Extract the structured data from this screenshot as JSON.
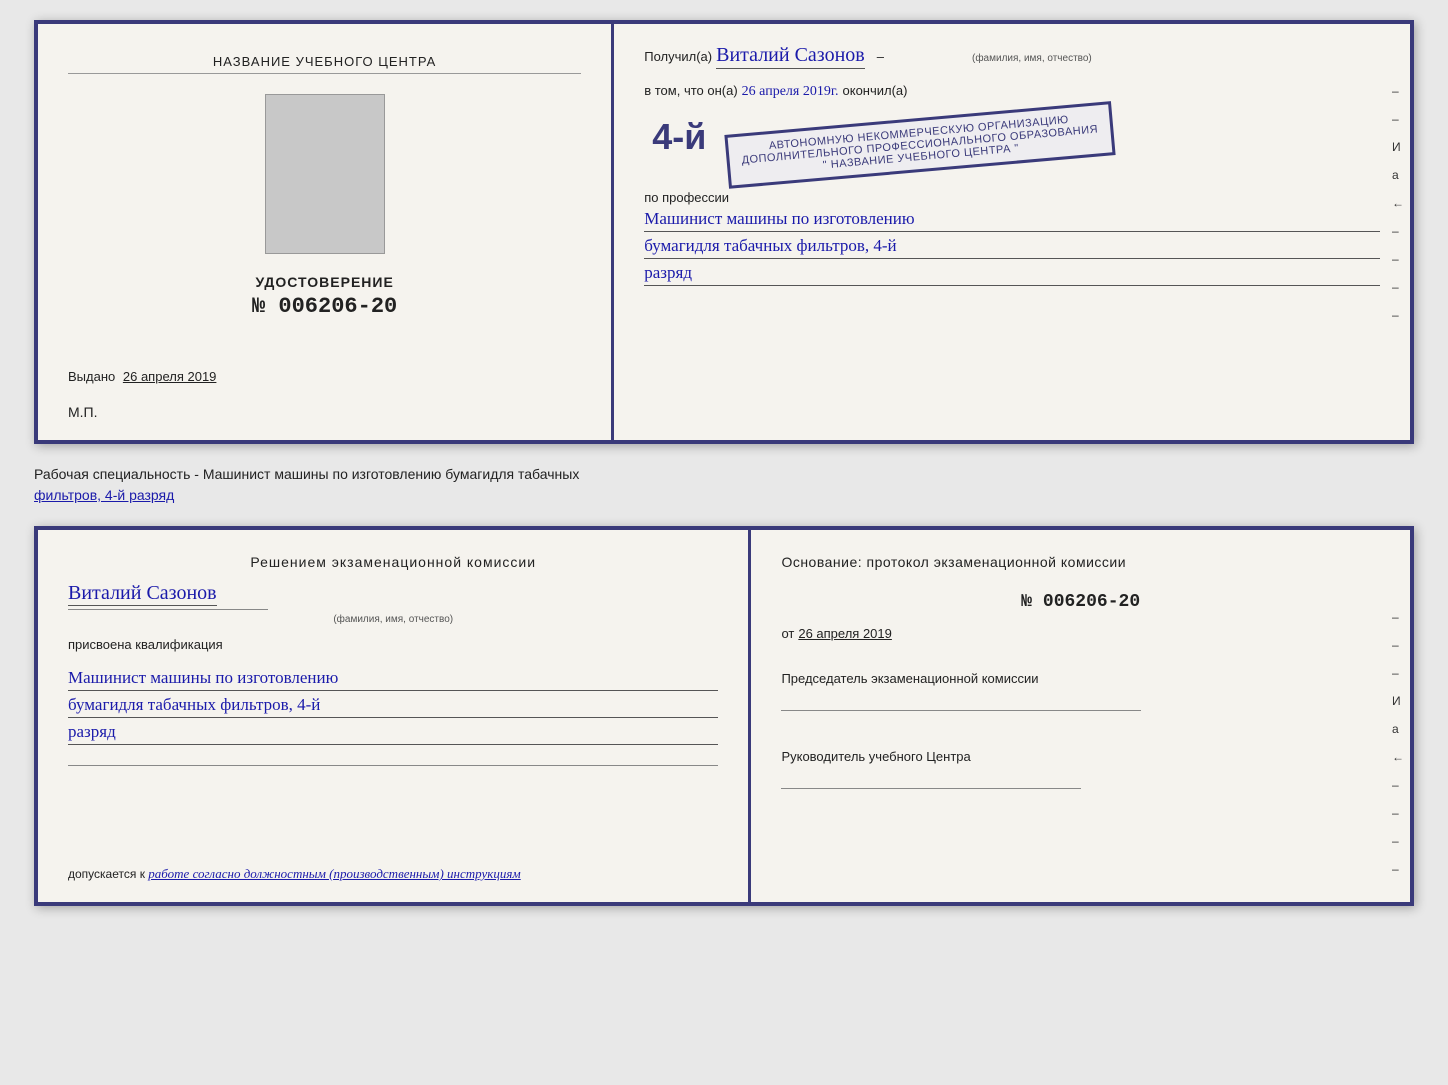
{
  "top_left": {
    "center_title": "НАЗВАНИЕ УЧЕБНОГО ЦЕНТРА",
    "udostoverenie_label": "УДОСТОВЕРЕНИЕ",
    "udostoverenie_number": "№ 006206-20",
    "vydano_label": "Выдано",
    "vydano_date": "26 апреля 2019",
    "mp": "М.П."
  },
  "top_right": {
    "poluchil_label": "Получил(а)",
    "recipient_name": "Виталий Сазонов",
    "fio_subtext": "(фамилия, имя, отчество)",
    "v_tom_label": "в том, что он(а)",
    "date_filled": "26 апреля 2019г.",
    "okonchil_label": "окончил(а)",
    "stamp_line1": "4-й",
    "stamp_line2": "АВТОНОМНУЮ НЕКОММЕРЧЕСКУЮ ОРГАНИЗАЦИЮ",
    "stamp_line3": "ДОПОЛНИТЕЛЬНОГО ПРОФЕССИОНАЛЬНОГО ОБРАЗОВАНИЯ",
    "stamp_line4": "\" НАЗВАНИЕ УЧЕБНОГО ЦЕНТРА \"",
    "po_professii": "по профессии",
    "profession1": "Машинист машины по изготовлению",
    "profession2": "бумагидля табачных фильтров, 4-й",
    "profession3": "разряд",
    "side_marks": [
      "–",
      "–",
      "И",
      "а",
      "←",
      "–",
      "–",
      "–",
      "–"
    ]
  },
  "specialty_text": "Рабочая специальность - Машинист машины по изготовлению бумагидля табачных",
  "specialty_text2": "фильтров, 4-й разряд",
  "bottom_left": {
    "resheniem_title": "Решением экзаменационной комиссии",
    "fio_name": "Виталий Сазонов",
    "fio_subtext": "(фамилия, имя, отчество)",
    "prisvoena_label": "присвоена квалификация",
    "qual1": "Машинист машины по изготовлению",
    "qual2": "бумагидля табачных фильтров, 4-й",
    "qual3": "разряд",
    "dopuskaetsya_label": "допускается к",
    "dopuskaetsya_value": "работе согласно должностным (производственным) инструкциям"
  },
  "bottom_right": {
    "osnovanie_label": "Основание: протокол экзаменационной комиссии",
    "number": "№ 006206-20",
    "ot_label": "от",
    "ot_date": "26 апреля 2019",
    "predsedatel_label": "Председатель экзаменационной комиссии",
    "rukovoditel_label": "Руководитель учебного Центра",
    "side_marks": [
      "–",
      "–",
      "–",
      "И",
      "а",
      "←",
      "–",
      "–",
      "–",
      "–"
    ]
  }
}
